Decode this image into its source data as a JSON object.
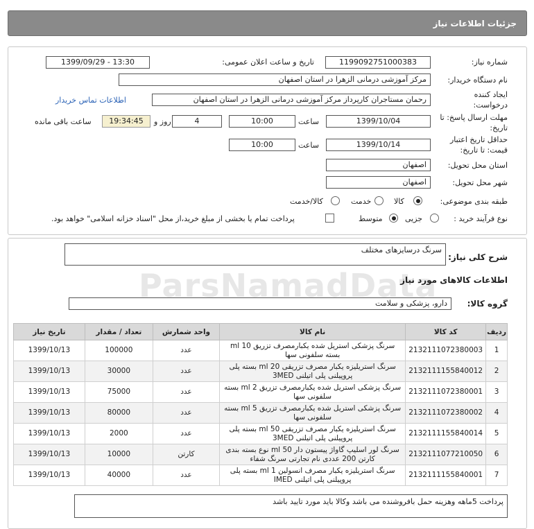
{
  "page_title": "جزئیات اطلاعات نیاز",
  "labels": {
    "need_number": "شماره نیاز:",
    "announce_datetime": "تاریخ و ساعت اعلان عمومی:",
    "buyer_org": "نام دستگاه خریدار:",
    "request_creator": "ایجاد کننده درخواست:",
    "reply_deadline": "مهلت ارسال پاسخ: تا تاریخ:",
    "hour": "ساعت",
    "day_and": "روز و",
    "remaining": "ساعت باقی مانده",
    "price_validity": "حداقل تاریخ اعتبار قیمت: تا تاریخ:",
    "delivery_province": "استان محل تحویل:",
    "delivery_city": "شهر محل تحویل:",
    "category": "طبقه بندی موضوعی:",
    "purchase_process": "نوع فرآیند خرید :",
    "contact_link": "اطلاعات تماس خریدار",
    "general_desc": "شرح کلی نیاز:",
    "goods_info": "اطلاعات کالاهای مورد نیاز",
    "goods_group": "گروه کالا:"
  },
  "values": {
    "need_number": "1199092751000383",
    "announce_datetime": "1399/09/29 - 13:30",
    "buyer_org": "مرکز آموزشی درمانی الزهرا در استان اصفهان",
    "request_creator": "رحمان مستاجران کارپرداز مرکز آموزشی درمانی الزهرا در استان اصفهان",
    "reply_date": "1399/10/04",
    "reply_time": "10:00",
    "days_left": "4",
    "time_left": "19:34:45",
    "validity_date": "1399/10/14",
    "validity_time": "10:00",
    "province": "اصفهان",
    "city": "اصفهان",
    "general_desc": "سرنگ درسایزهای مختلف",
    "goods_group": "دارو، پزشکی و سلامت",
    "footer_note": "پرداخت 5ماهه وهزینه حمل بافروشنده می باشد وکالا باید مورد تایید باشد"
  },
  "category_options": [
    {
      "label": "کالا",
      "selected": true
    },
    {
      "label": "خدمت",
      "selected": false
    },
    {
      "label": "کالا/خدمت",
      "selected": false
    }
  ],
  "process_options": [
    {
      "label": "جزیی",
      "selected": false
    },
    {
      "label": "متوسط",
      "selected": true
    }
  ],
  "payment_note": "پرداخت تمام یا بخشی از مبلغ خرید،از محل \"اسناد خزانه اسلامی\" خواهد بود.",
  "watermark_text": "ParsNamadData",
  "table": {
    "headers": [
      "ردیف",
      "کد کالا",
      "نام کالا",
      "واحد شمارش",
      "تعداد / مقدار",
      "تاریخ نیاز"
    ],
    "rows": [
      [
        "1",
        "2132111072380003",
        "سرنگ پزشکی استریل شده یکبارمصرف تزریق 10 ml بسته سلفونی سها",
        "عدد",
        "100000",
        "1399/10/13"
      ],
      [
        "2",
        "2132111155840012",
        "سرنگ استریلیزه یکبار مصرف تزریقی 20 ml بسته پلی پروپیلنی پلی اتیلنی 3MED",
        "عدد",
        "30000",
        "1399/10/13"
      ],
      [
        "3",
        "2132111072380001",
        "سرنگ پزشکی استریل شده یکبارمصرف تزریق 2 ml بسته سلفونی سها",
        "عدد",
        "75000",
        "1399/10/13"
      ],
      [
        "4",
        "2132111072380002",
        "سرنگ پزشکی استریل شده یکبارمصرف تزریق 5 ml بسته سلفونی سها",
        "عدد",
        "80000",
        "1399/10/13"
      ],
      [
        "5",
        "2132111155840014",
        "سرنگ استریلیزه یکبار مصرف تزریقی 50 ml بسته پلی پروپیلنی پلی اتیلنی 3MED",
        "عدد",
        "2000",
        "1399/10/13"
      ],
      [
        "6",
        "2132111077210050",
        "سرنگ لور اسلیپ گاواژ پیستون دار 50 ml نوع بسته بندی کارتن 200 عددی نام تجارتی سرنگ شفاء",
        "کارتن",
        "10000",
        "1399/10/13"
      ],
      [
        "7",
        "2132111155840001",
        "سرنگ استریلیزه یکبار مصرف انسولین 1 ml بسته پلی پروپیلنی پلی اتیلنی IMED",
        "عدد",
        "40000",
        "1399/10/13"
      ]
    ]
  }
}
